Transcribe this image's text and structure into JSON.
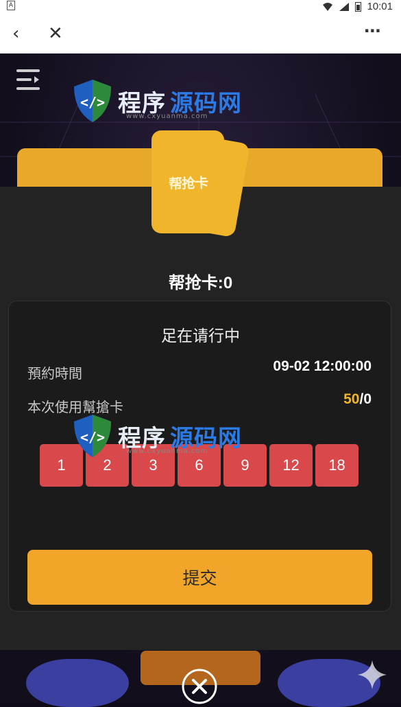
{
  "status_bar": {
    "time": "10:01"
  },
  "nav": {
    "back_icon": "chevron-left",
    "close_icon": "x",
    "more_icon": "…"
  },
  "card": {
    "label": "帮抢卡",
    "count_label": "帮抢卡:",
    "count_value": "0"
  },
  "panel": {
    "title": "足在请行中",
    "reserve_label": "預約時間",
    "reserve_value": "09-02 12:00:00",
    "use_label": "本次使用幫搶卡",
    "use_value_main": "50",
    "use_value_rest": "/0"
  },
  "chips": [
    "1",
    "2",
    "3",
    "6",
    "9",
    "12",
    "18"
  ],
  "submit": {
    "label": "提交"
  },
  "watermark": {
    "text_a": "程序",
    "text_b": "源码网",
    "url": "www.cxyuanma.com"
  },
  "colors": {
    "accent": "#f1a629",
    "chip": "#d9484a",
    "panel": "#232323"
  }
}
